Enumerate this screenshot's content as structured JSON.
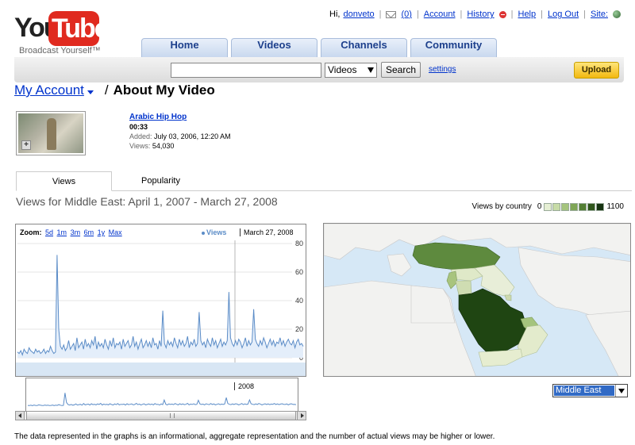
{
  "logo": {
    "you": "You",
    "tube": "Tube",
    "tagline": "Broadcast Yourself™"
  },
  "toplinks": {
    "greeting": "Hi,",
    "username": "donveto",
    "inbox_count": "(0)",
    "account": "Account",
    "history": "History",
    "help": "Help",
    "logout": "Log Out",
    "site": "Site:"
  },
  "nav": {
    "tabs": [
      "Home",
      "Videos",
      "Channels",
      "Community"
    ]
  },
  "search": {
    "value": "",
    "scope": "Videos",
    "button": "Search",
    "settings": "settings"
  },
  "upload_label": "Upload",
  "breadcrumb": {
    "account": "My Account",
    "separator": "/",
    "title": "About My Video"
  },
  "video": {
    "title": "Arabic Hip Hop",
    "duration": "00:33",
    "added_label": "Added:",
    "added_value": "July 03, 2006, 12:20 AM",
    "views_label": "Views:",
    "views_value": "54,030"
  },
  "subtabs": {
    "views": "Views",
    "popularity": "Popularity"
  },
  "views_heading": "Views for Middle East: April 1, 2007 - March 27, 2008",
  "legend": {
    "label": "Views by country",
    "min": "0",
    "max": "1100",
    "colors": [
      "#e6efd4",
      "#c7dba7",
      "#a5c47d",
      "#7fa656",
      "#547f34",
      "#30561c",
      "#173312"
    ]
  },
  "chart_header": {
    "zoom_label": "Zoom:",
    "zoom_options": [
      "5d",
      "1m",
      "3m",
      "6m",
      "1y",
      "Max"
    ],
    "series_label": "Views",
    "date": "March 27, 2008",
    "overview_year": "2008"
  },
  "chart_data": {
    "type": "line",
    "title": "",
    "xlabel": "",
    "ylabel": "",
    "ylim": [
      0,
      80
    ],
    "y_ticks": [
      "80",
      "60",
      "40",
      "20",
      "0"
    ],
    "series": [
      {
        "name": "Views",
        "color": "#5b8cc7",
        "values": [
          4,
          3,
          5,
          2,
          6,
          4,
          3,
          7,
          5,
          4,
          3,
          6,
          4,
          5,
          3,
          4,
          6,
          3,
          5,
          4,
          8,
          5,
          3,
          4,
          72,
          20,
          8,
          6,
          9,
          5,
          7,
          12,
          6,
          8,
          10,
          5,
          14,
          7,
          9,
          11,
          6,
          13,
          8,
          10,
          7,
          12,
          9,
          15,
          6,
          11,
          8,
          10,
          7,
          13,
          9,
          6,
          12,
          8,
          14,
          7,
          10,
          9,
          11,
          6,
          13,
          8,
          10,
          12,
          7,
          9,
          15,
          8,
          11,
          6,
          10,
          13,
          7,
          9,
          12,
          8,
          11,
          7,
          14,
          9,
          10,
          6,
          12,
          8,
          33,
          10,
          7,
          12,
          9,
          11,
          8,
          14,
          10,
          7,
          13,
          9,
          12,
          8,
          10,
          15,
          7,
          11,
          9,
          13,
          8,
          10,
          32,
          12,
          9,
          11,
          7,
          13,
          10,
          8,
          14,
          9,
          12,
          7,
          10,
          13,
          8,
          11,
          9,
          12,
          46,
          14,
          10,
          8,
          12,
          9,
          13,
          11,
          7,
          10,
          14,
          8,
          12,
          9,
          11,
          34,
          13,
          10,
          8,
          12,
          9,
          14,
          11,
          7,
          10,
          13,
          9,
          12,
          8,
          11,
          10,
          14,
          9,
          12,
          8,
          11,
          13,
          10,
          9,
          12,
          7,
          11,
          13,
          9,
          10,
          8
        ]
      }
    ]
  },
  "region": {
    "selected": "Middle East"
  },
  "disclaimer": "The data represented in the graphs is an informational, aggregate representation and the number of actual views may be higher or lower."
}
